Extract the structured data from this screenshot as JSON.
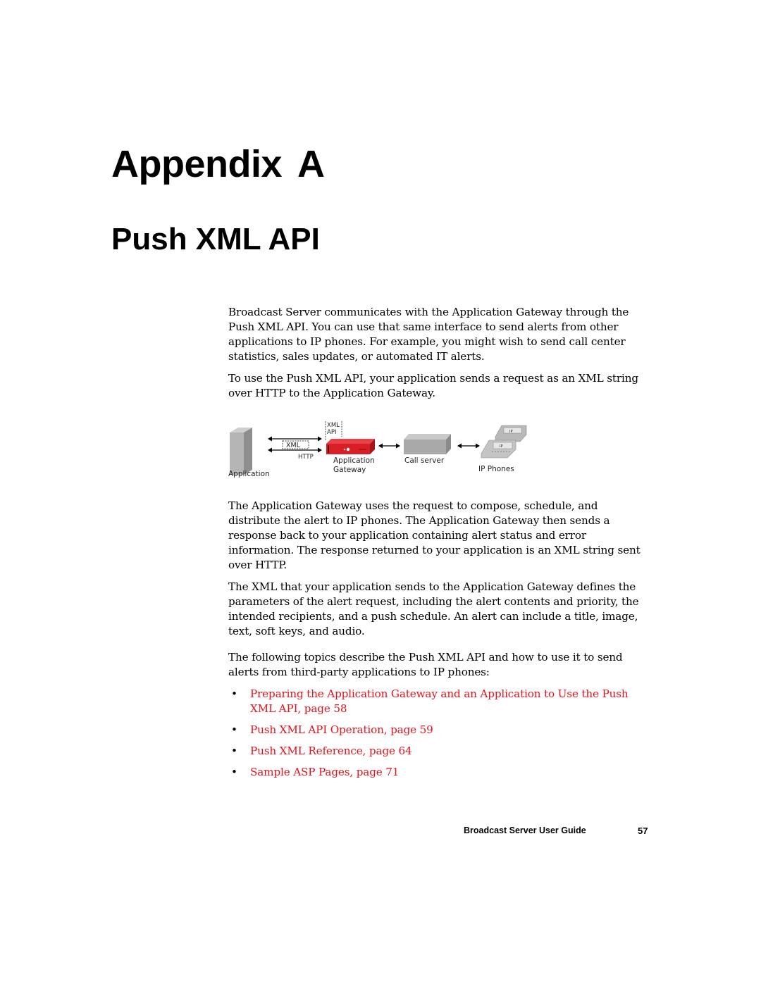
{
  "header": {
    "chapter_label": "Appendix",
    "chapter_letter": "A",
    "chapter_title": "Push XML API"
  },
  "body": {
    "paragraphs": [
      "Broadcast Server communicates with the Application Gateway through the Push XML API. You can use that same interface to send alerts from other applications to IP phones. For example, you might wish to send call center statistics, sales updates, or automated IT alerts.",
      "To use the Push XML API, your application sends a request as an XML string over HTTP to the Application Gateway.",
      "The Application Gateway uses the request to compose, schedule, and distribute the alert to IP phones. The Application Gateway then sends a response back to your application containing alert status and error information. The response returned to your application is an XML string sent over HTTP.",
      "The XML that your application sends to the Application Gateway defines the parameters of the alert request, including the alert contents and priority, the intended recipients, and a push schedule. An alert can include a title, image, text, soft keys, and audio.",
      "The following topics describe the Push XML API and how to use it to send alerts from third-party applications to IP phones:"
    ],
    "topics": [
      {
        "bullet": "•",
        "label": "Preparing the Application Gateway and an Application to Use the Push XML API, page 58"
      },
      {
        "bullet": "•",
        "label": "Push XML API Operation, page 59"
      },
      {
        "bullet": "•",
        "label": "Push XML Reference, page 64"
      },
      {
        "bullet": "•",
        "label": "Sample ASP Pages, page 71"
      }
    ],
    "link_color": "#e8121a"
  },
  "diagram": {
    "labels": {
      "application": "Application",
      "xml_box": "XML",
      "http": "HTTP",
      "xml_api_line1": "XML",
      "xml_api_line2": "API",
      "gateway_line1": "Application",
      "gateway_line2": "Gateway",
      "call_server": "Call server",
      "ip_phones": "IP Phones",
      "phone_screen": "IP"
    },
    "colors": {
      "gateway_red": "#d91f26",
      "device_gray": "#a9a9a9"
    }
  },
  "footer": {
    "guide_title": "Broadcast Server User Guide",
    "page_number": "57"
  }
}
